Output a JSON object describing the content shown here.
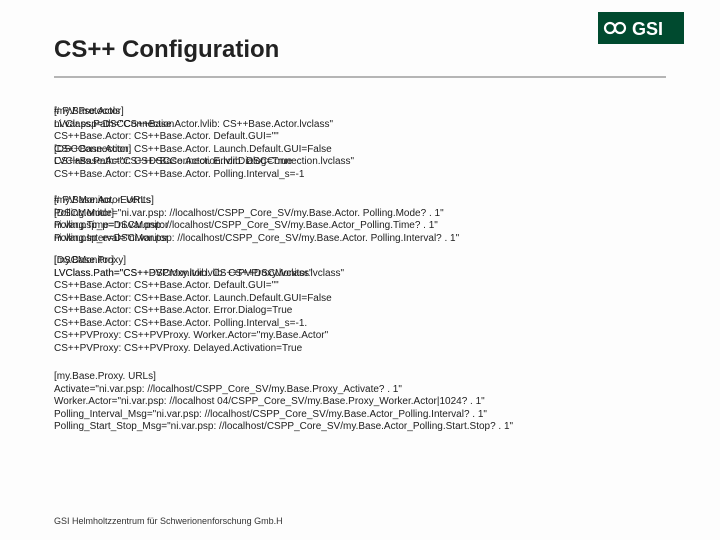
{
  "header": {
    "title": "CS++ Configuration"
  },
  "logo": {
    "text": "GSI",
    "bg_color": "#004a2f",
    "fg_color": "#ffffff"
  },
  "blocks": {
    "baseActorBack": "[my.Base.Actor]\nLVClass.Path=\"CS++Base.Actor.lvlib: CS++Base.Actor.lvclass\"\nCS++Base.Actor: CS++Base.Actor. Default.GUI=\"\"\nCS++Base.Actor: CS++Base.Actor. Launch.Default.GUI=False\nCS++Base.Actor: CS++Base.Actor. Error.Dialog=True\nCS++Base.Actor: CS++Base.Actor. Polling.Interval_s=-1",
    "baseActorFront": "# PV-Protocols\nni.var.psp=DSCConnection\n\n[DSCConnection]\nLVClass.Path=\"CS++DSCConnection.lvlib: DSCConnection.lvclass\"",
    "urlsBack": "[my.Base.Actor. URLs]\nPolling.Mode=\"ni.var.psp: //localhost/CSPP_Core_SV/my.Base.Actor. Polling.Mode? . 1\"\nPolling.Time=\"ni.var.psp: //localhost/CSPP_Core_SV/my.Base.Actor_Polling.Time? . 1\"\nPolling.Interval=\"ni.var.psp: //localhost/CSPP_Core_SV/my.Base.Actor. Polling.Interval? . 1\"",
    "urlsFront": "# PV-Monitor, -Events\n[DSCMonitor]\nni.var.psp_p=DSCMonitor\nni.var.psp_e=DSCMonitor",
    "proxyBack": "[my.Base.Proxy]\nLVClass.Path=\"CS++PVProxy.lvlib: CS++PVProxy.lvclass\"\nCS++Base.Actor: CS++Base.Actor. Default.GUI=\"\"\nCS++Base.Actor: CS++Base.Actor. Launch.Default.GUI=False\nCS++Base.Actor: CS++Base.Actor. Error.Dialog=True\nCS++Base.Actor: CS++Base.Actor. Polling.Interval_s=-1.\nCS++PVProxy: CS++PVProxy. Worker.Actor=\"my.Base.Actor\"\nCS++PVProxy: CS++PVProxy. Delayed.Activation=True",
    "proxyFront": "[DSCMonitor]\nLVClass.Path=\"CS++DSCMonitor.lvlib: CS++DSCMonitor.lvclass\"",
    "proxyUrls": "[my.Base.Proxy. URLs]\nActivate=\"ni.var.psp: //localhost/CSPP_Core_SV/my.Base.Proxy_Activate? . 1\"\nWorker.Actor=\"ni.var.psp: //localhost 04/CSPP_Core_SV/my.Base.Proxy_Worker.Actor|1024? . 1\"\nPolling_Interval_Msg=\"ni.var.psp: //localhost/CSPP_Core_SV/my.Base.Actor_Polling.Interval? . 1\"\nPolling_Start_Stop_Msg=\"ni.var.psp: //localhost/CSPP_Core_SV/my.Base.Actor_Polling.Start.Stop? . 1\""
  },
  "footer": {
    "text": "GSI Helmholtzzentrum für Schwerionenforschung Gmb.H"
  }
}
